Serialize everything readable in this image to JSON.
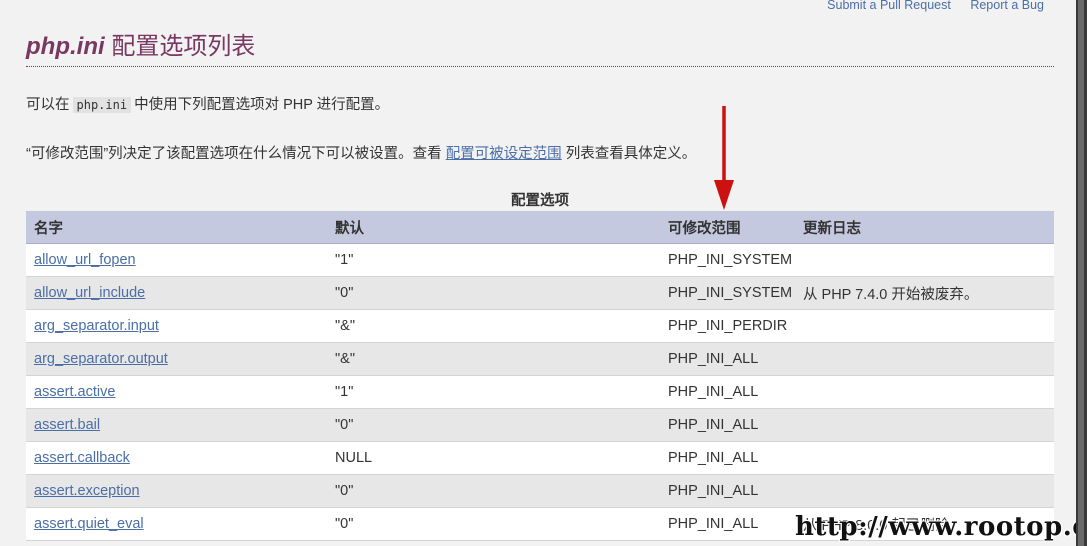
{
  "toplinks": {
    "pull_request": "Submit a Pull Request",
    "bug": "Report a Bug"
  },
  "title": {
    "code": "php.ini",
    "text": " 配置选项列表"
  },
  "intro": {
    "before": "可以在",
    "code": "php.ini",
    "after": "中使用下列配置选项对 PHP 进行配置。"
  },
  "changeable": {
    "before": "“可修改范围”列决定了该配置选项在什么情况下可以被设置。查看 ",
    "link": "配置可被设定范围",
    "after": " 列表查看具体定义。"
  },
  "table": {
    "caption": "配置选项",
    "headers": [
      "名字",
      "默认",
      "可修改范围",
      "更新日志"
    ],
    "rows": [
      {
        "name": "allow_url_fopen",
        "default": "\"1\"",
        "changeable": "PHP_INI_SYSTEM",
        "changelog": ""
      },
      {
        "name": "allow_url_include",
        "default": "\"0\"",
        "changeable": "PHP_INI_SYSTEM",
        "changelog": "从 PHP 7.4.0 开始被废弃。"
      },
      {
        "name": "arg_separator.input",
        "default": "\"&\"",
        "changeable": "PHP_INI_PERDIR",
        "changelog": ""
      },
      {
        "name": "arg_separator.output",
        "default": "\"&\"",
        "changeable": "PHP_INI_ALL",
        "changelog": ""
      },
      {
        "name": "assert.active",
        "default": "\"1\"",
        "changeable": "PHP_INI_ALL",
        "changelog": ""
      },
      {
        "name": "assert.bail",
        "default": "\"0\"",
        "changeable": "PHP_INI_ALL",
        "changelog": ""
      },
      {
        "name": "assert.callback",
        "default": "NULL",
        "changeable": "PHP_INI_ALL",
        "changelog": ""
      },
      {
        "name": "assert.exception",
        "default": "\"0\"",
        "changeable": "PHP_INI_ALL",
        "changelog": ""
      },
      {
        "name": "assert.quiet_eval",
        "default": "\"0\"",
        "changeable": "PHP_INI_ALL",
        "changelog": "从 PHP 8.0.0 起已删除。"
      }
    ]
  },
  "watermark": "http://www.rootop.org",
  "colors": {
    "title": "#793862",
    "link": "#4b6ea6",
    "header_bg": "#c4c9df",
    "arrow": "#cc1111"
  }
}
